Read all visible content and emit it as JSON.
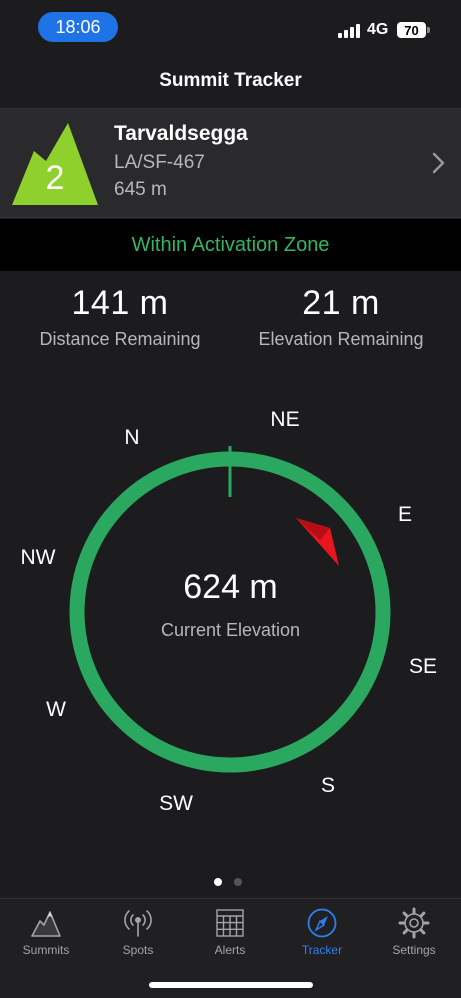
{
  "status_bar": {
    "time": "18:06",
    "network": "4G",
    "battery": "70"
  },
  "nav": {
    "title": "Summit Tracker"
  },
  "summit": {
    "points": "2",
    "name": "Tarvaldsegga",
    "reference": "LA/SF-467",
    "height": "645 m"
  },
  "zone": {
    "status": "Within Activation Zone"
  },
  "stats": {
    "distance": {
      "value": "141 m",
      "label": "Distance Remaining"
    },
    "elevation": {
      "value": "21 m",
      "label": "Elevation Remaining"
    }
  },
  "compass": {
    "labels": {
      "N": "N",
      "NE": "NE",
      "E": "E",
      "SE": "SE",
      "S": "S",
      "SW": "SW",
      "W": "W",
      "NW": "NW"
    },
    "current_elevation": "624 m",
    "current_elevation_label": "Current Elevation",
    "ring_color": "#2aa85f",
    "pointer_color": "#e8141e"
  },
  "pager": {
    "pages": 2,
    "active": 1
  },
  "tabs": [
    {
      "label": "Summits",
      "icon": "mountain-icon",
      "active": false
    },
    {
      "label": "Spots",
      "icon": "antenna-icon",
      "active": false
    },
    {
      "label": "Alerts",
      "icon": "calendar-icon",
      "active": false
    },
    {
      "label": "Tracker",
      "icon": "compass-icon",
      "active": true
    },
    {
      "label": "Settings",
      "icon": "gear-icon",
      "active": false
    }
  ],
  "colors": {
    "accent": "#2f7ff2",
    "zone_green": "#35b563",
    "summit_green": "#8fd12c"
  }
}
